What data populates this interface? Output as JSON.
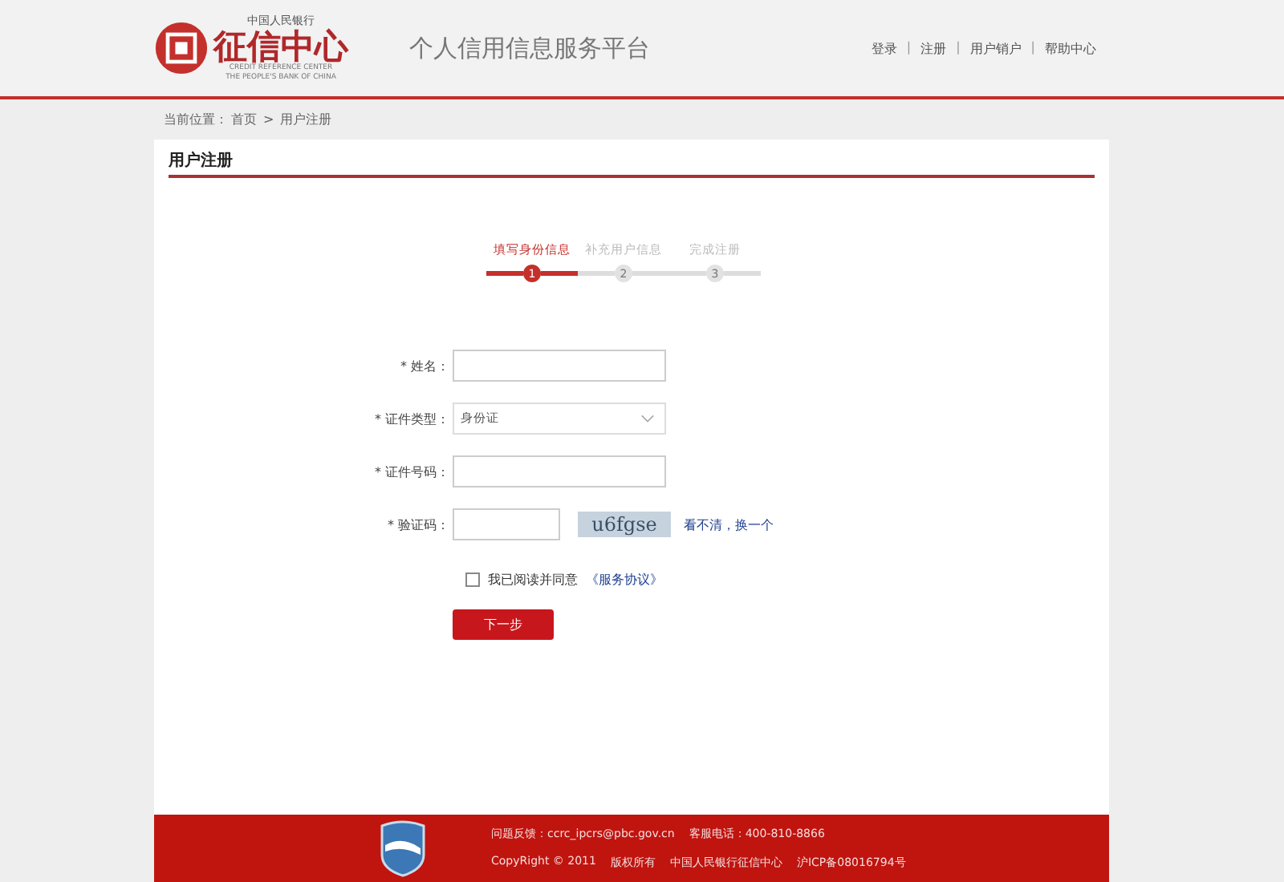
{
  "header": {
    "logo": {
      "top_text": "中国人民银行",
      "name": "征信中心",
      "english_lines": [
        "CREDIT REFERENCE CENTER",
        "THE PEOPLE'S BANK OF CHINA"
      ]
    },
    "platform_title": "个人信用信息服务平台",
    "nav_links": [
      "登录",
      "注册",
      "用户销户",
      "帮助中心"
    ],
    "nav_separator": "|"
  },
  "breadcrumb": {
    "prefix": "当前位置：",
    "links": [
      "首页",
      "用户注册"
    ],
    "separator": ">"
  },
  "panel_title": "用户注册",
  "steps": [
    {
      "label": "填写身份信息",
      "number": "1",
      "selected": true
    },
    {
      "label": "补充用户信息",
      "number": "2",
      "selected": false
    },
    {
      "label": "完成注册",
      "number": "3",
      "selected": false
    }
  ],
  "form": {
    "fields": [
      {
        "kind": "text",
        "required_mark": "*",
        "label": "姓名："
      },
      {
        "kind": "select",
        "required_mark": "*",
        "label": "证件类型：",
        "value": "身份证"
      },
      {
        "kind": "text",
        "required_mark": "*",
        "label": "证件号码："
      },
      {
        "kind": "captcha",
        "required_mark": "*",
        "label": "验证码：",
        "captcha_text": "u6fgse",
        "refresh_link": "看不清，换一个"
      }
    ],
    "agreement": {
      "checked": false,
      "text": "我已阅读并同意",
      "link": "《服务协议》"
    },
    "submit": "下一步"
  },
  "footer": {
    "lines": [
      [
        "问题反馈：ccrc_ipcrs@pbc.gov.cn",
        "客服电话：400-810-8866"
      ],
      [
        "CopyRight © 2011",
        "版权所有",
        "中国人民银行征信中心",
        "沪ICP备08016794号"
      ]
    ]
  }
}
